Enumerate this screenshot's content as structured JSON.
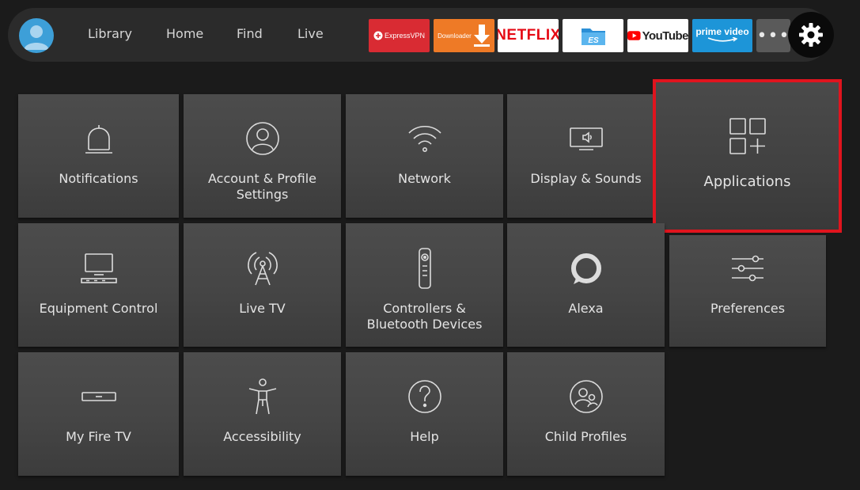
{
  "nav": {
    "items": [
      "Library",
      "Home",
      "Find",
      "Live"
    ]
  },
  "apps": [
    {
      "name": "expressvpn-app-tile",
      "label": "ExpressVPN",
      "bg": "#d92b33",
      "fg": "#ffffff"
    },
    {
      "name": "downloader-app-tile",
      "label": "Downloader",
      "bg": "#ee7a26",
      "fg": "#ffffff"
    },
    {
      "name": "netflix-app-tile",
      "label": "NETFLIX",
      "bg": "#ffffff",
      "fg": "#e50914"
    },
    {
      "name": "es-file-explorer-app-tile",
      "label": "",
      "bg": "#ffffff",
      "fg": "#2b8fd6"
    },
    {
      "name": "youtube-app-tile",
      "label": "YouTube",
      "bg": "#ffffff",
      "fg": "#222222"
    },
    {
      "name": "prime-video-app-tile",
      "label": "prime video",
      "bg": "#1d95d8",
      "fg": "#ffffff"
    }
  ],
  "more_label": "•••",
  "settings": {
    "tiles": [
      {
        "label": "Notifications",
        "icon": "bell-icon"
      },
      {
        "label": "Account & Profile Settings",
        "icon": "user-circle-icon"
      },
      {
        "label": "Network",
        "icon": "wifi-icon"
      },
      {
        "label": "Display & Sounds",
        "icon": "display-sound-icon"
      },
      {
        "label": "Applications",
        "icon": "applications-grid-icon",
        "focused": true
      },
      {
        "label": "Equipment Control",
        "icon": "tv-equipment-icon"
      },
      {
        "label": "Live TV",
        "icon": "antenna-icon"
      },
      {
        "label": "Controllers & Bluetooth Devices",
        "icon": "remote-icon"
      },
      {
        "label": "Alexa",
        "icon": "alexa-ring-icon"
      },
      {
        "label": "Preferences",
        "icon": "sliders-icon"
      },
      {
        "label": "My Fire TV",
        "icon": "fire-tv-device-icon"
      },
      {
        "label": "Accessibility",
        "icon": "accessibility-icon"
      },
      {
        "label": "Help",
        "icon": "help-icon"
      },
      {
        "label": "Child Profiles",
        "icon": "child-profiles-icon"
      }
    ]
  },
  "colors": {
    "focus_outline": "#e0141e",
    "avatar_blue": "#3d9fd8"
  }
}
